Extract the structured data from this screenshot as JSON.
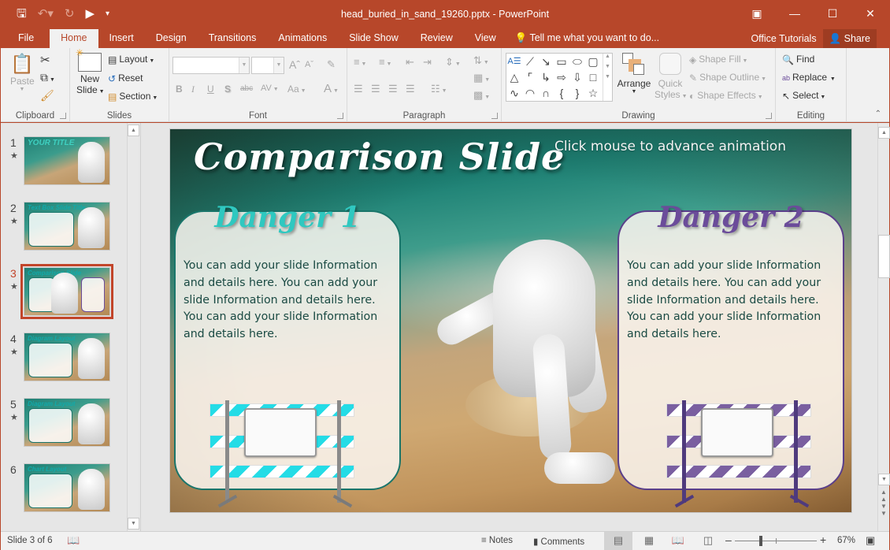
{
  "window": {
    "title": "head_buried_in_sand_19260.pptx - PowerPoint",
    "controls": [
      "ribbon-display-options",
      "minimize",
      "maximize",
      "close"
    ]
  },
  "quick_access": {
    "save": "save-icon",
    "undo": "undo-icon",
    "redo": "redo-icon",
    "present": "start-from-beginning-icon",
    "customize": "customize-qat-icon"
  },
  "tabs": [
    "File",
    "Home",
    "Insert",
    "Design",
    "Transitions",
    "Animations",
    "Slide Show",
    "Review",
    "View"
  ],
  "active_tab": "Home",
  "tell_me": "Tell me what you want to do...",
  "office_tutorials": "Office Tutorials",
  "share": "Share",
  "ribbon": {
    "clipboard": {
      "label": "Clipboard",
      "paste": "Paste"
    },
    "slides": {
      "label": "Slides",
      "new_slide_1": "New",
      "new_slide_2": "Slide",
      "layout": "Layout",
      "reset": "Reset",
      "section": "Section"
    },
    "font": {
      "label": "Font",
      "font_name": "",
      "font_size": "",
      "bold": "B",
      "italic": "I",
      "underline": "U",
      "shadow": "S",
      "strikethrough": "abc",
      "spacing": "AV",
      "case": "Aa",
      "color": "A",
      "grow": "A",
      "shrink": "A"
    },
    "paragraph": {
      "label": "Paragraph"
    },
    "drawing": {
      "label": "Drawing",
      "arrange": "Arrange",
      "quick_styles_1": "Quick",
      "quick_styles_2": "Styles",
      "shape_fill": "Shape Fill",
      "shape_outline": "Shape Outline",
      "shape_effects": "Shape Effects"
    },
    "editing": {
      "label": "Editing",
      "find": "Find",
      "replace": "Replace",
      "select": "Select"
    }
  },
  "thumbnails": [
    {
      "num": "1",
      "title": "YOUR TITLE",
      "has_animation": true
    },
    {
      "num": "2",
      "title": "Text Box Slide Title",
      "has_animation": true
    },
    {
      "num": "3",
      "title": "Comparison Slide",
      "has_animation": true,
      "selected": true
    },
    {
      "num": "4",
      "title": "Diagram Layout",
      "has_animation": true
    },
    {
      "num": "5",
      "title": "Diagram Layout",
      "has_animation": true
    },
    {
      "num": "6",
      "title": "Chart Layout",
      "has_animation": false
    }
  ],
  "slide": {
    "title": "Comparison Slide",
    "hint": "Click mouse to advance animation",
    "panels": [
      {
        "heading": "Danger 1",
        "color": "#19756a",
        "text": "You can add your slide Information and details here. You can add your slide Information and details here. You can add your slide Information and details here."
      },
      {
        "heading": "Danger 2",
        "color": "#5a3f8a",
        "text": "You can add your slide Information and details here. You can add your slide Information and details here. You can add your slide Information and details here."
      }
    ]
  },
  "status": {
    "slide_info": "Slide 3 of 6",
    "notes": "Notes",
    "comments": "Comments",
    "zoom": "67%",
    "zoom_value": 67
  },
  "colors": {
    "accent": "#b7472a",
    "selected_thumb": "#c2452a",
    "danger1": "#2fc8c0",
    "danger2": "#6b4c9a"
  }
}
